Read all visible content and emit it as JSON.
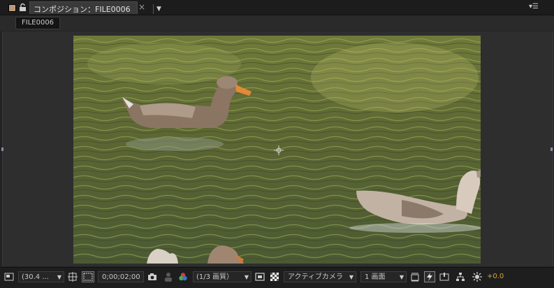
{
  "tab": {
    "title": "コンポジション：FILE0006",
    "dropdown_icon": "chevron-down-icon",
    "close_icon": "close-icon"
  },
  "breadcrumb": {
    "label": "FILE0006"
  },
  "viewer": {
    "content": "duck-pond-frame"
  },
  "toolbar": {
    "magnification": "(30.4 ...",
    "timecode": "0;00;02;00",
    "resolution": "(1/3 画質）",
    "camera": "アクティブカメラ",
    "views": "1 画面",
    "exposure": "+0.0"
  },
  "colors": {
    "accent_exposure": "#d7a53a",
    "tab_label_color": "#b99a79"
  }
}
